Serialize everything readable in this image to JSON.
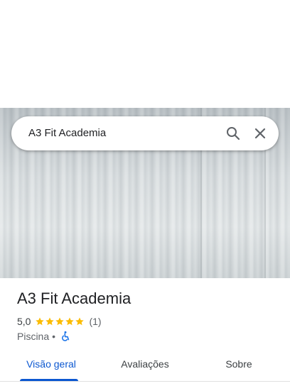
{
  "search": {
    "query": "A3 Fit Academia",
    "search_icon": "search-icon",
    "close_icon": "close-icon"
  },
  "place": {
    "name": "A3 Fit Academia",
    "rating": "5,0",
    "rating_stars": 5,
    "review_count": "(1)",
    "category": "Piscina",
    "separator": "•",
    "accessibility_icon": "wheelchair-icon"
  },
  "tabs": [
    {
      "label": "Visão geral",
      "selected": true
    },
    {
      "label": "Avaliações",
      "selected": false
    },
    {
      "label": "Sobre",
      "selected": false
    }
  ],
  "colors": {
    "accent": "#0b57d0",
    "star": "#fbbc04",
    "text": "#202124",
    "secondary_text": "#5f6368"
  }
}
